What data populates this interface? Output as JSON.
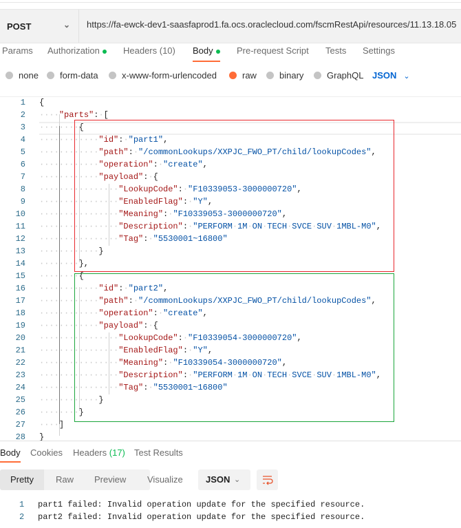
{
  "request": {
    "method": "POST",
    "url": "https://fa-ewck-dev1-saasfaprod1.fa.ocs.oraclecloud.com/fscmRestApi/resources/11.13.18.05"
  },
  "tabs": [
    "Params",
    "Authorization",
    "Headers (10)",
    "Body",
    "Pre-request Script",
    "Tests",
    "Settings"
  ],
  "body_types": [
    "none",
    "form-data",
    "x-www-form-urlencoded",
    "raw",
    "binary",
    "GraphQL"
  ],
  "selected_body_type": "raw",
  "raw_format": "JSON",
  "editor_lines": [
    "{",
    "    \"parts\": [",
    "        {",
    "            \"id\": \"part1\",",
    "            \"path\": \"/commonLookups/XXPJC_FWO_PT/child/lookupCodes\",",
    "            \"operation\": \"create\",",
    "            \"payload\": {",
    "                \"LookupCode\": \"F10339053-3000000720\",",
    "                \"EnabledFlag\": \"Y\",",
    "                \"Meaning\": \"F10339053-3000000720\",",
    "                \"Description\": \"PERFORM 1M ON TECH SVCE SUV 1MBL-M0\",",
    "                \"Tag\": \"5530001~16800\"",
    "            }",
    "        },",
    "        {",
    "            \"id\": \"part2\",",
    "            \"path\": \"/commonLookups/XXPJC_FWO_PT/child/lookupCodes\",",
    "            \"operation\": \"create\",",
    "            \"payload\": {",
    "                \"LookupCode\": \"F10339054-3000000720\",",
    "                \"EnabledFlag\": \"Y\",",
    "                \"Meaning\": \"F10339054-3000000720\",",
    "                \"Description\": \"PERFORM 1M ON TECH SVCE SUV 1MBL-M0\",",
    "                \"Tag\": \"5530001~16800\"",
    "            }",
    "        }",
    "    ]",
    "}"
  ],
  "response": {
    "tabs": {
      "body": "Body",
      "cookies": "Cookies",
      "headers": "Headers",
      "headers_count": "(17)",
      "tests": "Test Results"
    },
    "views": [
      "Pretty",
      "Raw",
      "Preview",
      "Visualize"
    ],
    "format": "JSON",
    "lines": [
      "part1 failed: Invalid operation update for the specified resource.",
      "part2 failed: Invalid operation update for the specified resource."
    ]
  },
  "colors": {
    "accent": "#ff6c37",
    "status_dot": "#0cbb52",
    "highlight_red": "#e8262b",
    "highlight_green": "#1aa53a"
  }
}
